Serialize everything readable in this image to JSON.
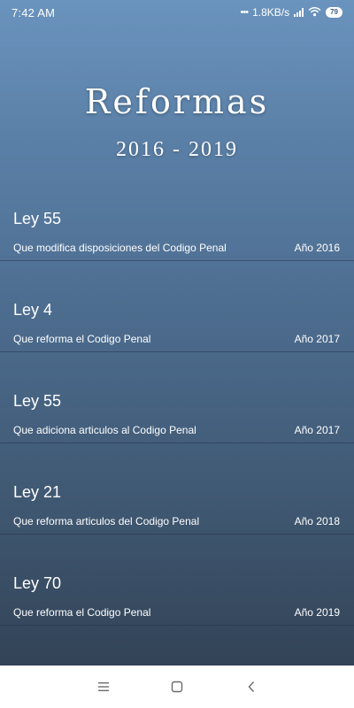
{
  "status_bar": {
    "time": "7:42 AM",
    "network_speed": "1.8KB/s",
    "battery": "79",
    "icons": [
      "more-dots-icon",
      "signal-icon",
      "wifi-icon",
      "battery-icon"
    ]
  },
  "header": {
    "title": "Reformas",
    "subtitle": "2016 - 2019"
  },
  "laws": [
    {
      "name": "Ley 55",
      "description": "Que modifica disposiciones del Codigo Penal",
      "year": "Año 2016"
    },
    {
      "name": "Ley 4",
      "description": "Que reforma el Codigo Penal",
      "year": "Año 2017"
    },
    {
      "name": "Ley 55",
      "description": "Que adiciona articulos al Codigo Penal",
      "year": "Año 2017"
    },
    {
      "name": "Ley 21",
      "description": "Que reforma articulos del Codigo Penal",
      "year": "Año 2018"
    },
    {
      "name": "Ley 70",
      "description": "Que reforma el Codigo Penal",
      "year": "Año 2019"
    }
  ],
  "nav_bar": {
    "icons": [
      "menu-icon",
      "home-icon",
      "back-icon"
    ]
  },
  "colors": {
    "gradient_top": "#6a93bd",
    "gradient_bottom": "#334357",
    "text": "#ffffff",
    "nav_icon": "#6b6b6b"
  }
}
